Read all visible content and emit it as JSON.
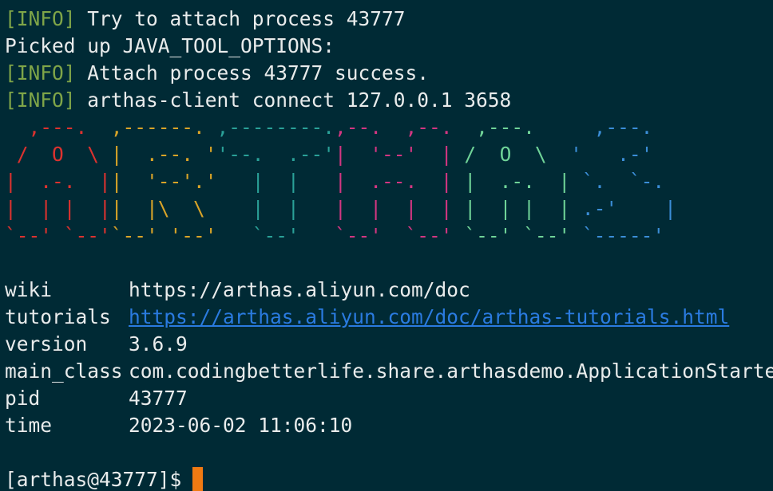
{
  "window": {
    "background": "#002a35",
    "foreground": "#e9ecec"
  },
  "log": [
    {
      "tag": "[INFO]",
      "text": " Try to attach process 43777"
    },
    {
      "tag": "",
      "text": "Picked up JAVA_TOOL_OPTIONS:"
    },
    {
      "tag": "[INFO]",
      "text": " Attach process 43777 success."
    },
    {
      "tag": "[INFO]",
      "text": " arthas-client connect 127.0.0.1 3658"
    }
  ],
  "banner": {
    "colors": [
      "#dc322f",
      "#d9a428",
      "#2aa198",
      "#d33682",
      "#6fd398",
      "#3b8ed8"
    ],
    "rows": [
      [
        "  ,---.  ",
        ",------. ",
        ",--------.",
        ",--.  ,--. ",
        " ,---.   ",
        "  ,---.  "
      ],
      [
        " /  O  \\ ",
        "|  .--. '",
        "'--.  .--'",
        "|  '--'  | ",
        "/  O  \\  ",
        "'   .-'  "
      ],
      [
        "|  .-.  |",
        "|  '--'.'",
        "   |  |   ",
        "|  .--.  | ",
        "|  .-.  | ",
        "`.  `-.  "
      ],
      [
        "|  | |  |",
        "|  |\\  \\ ",
        "   |  |   ",
        "|  |  |  | ",
        "|  | |  | ",
        ".-'    | "
      ],
      [
        "`--' `--'",
        "`--' '--'",
        "   `--'   ",
        "`--'  `--' ",
        "`--' `--' ",
        "`-----'  "
      ]
    ]
  },
  "info_table": [
    {
      "key": "wiki",
      "value": "https://arthas.aliyun.com/doc",
      "link": false
    },
    {
      "key": "tutorials",
      "value": "https://arthas.aliyun.com/doc/arthas-tutorials.html",
      "link": true
    },
    {
      "key": "version",
      "value": "3.6.9",
      "link": false
    },
    {
      "key": "main_class",
      "value": "com.codingbetterlife.share.arthasdemo.ApplicationStarter",
      "link": false
    },
    {
      "key": "pid",
      "value": "43777",
      "link": false
    },
    {
      "key": "time",
      "value": "2023-06-02 11:06:10",
      "link": false
    }
  ],
  "prompt": {
    "text": "[arthas@43777]$",
    "cursor_color": "#f07a12"
  }
}
